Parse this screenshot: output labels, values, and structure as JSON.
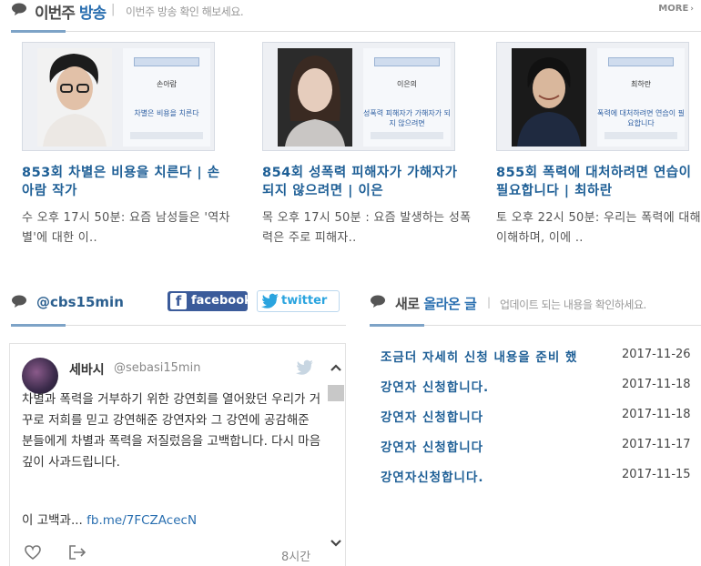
{
  "broadcast": {
    "title_part1": "이번주",
    "title_part2": "방송",
    "description": "이번주 방송 확인 해보세요.",
    "more_label": "MORE",
    "episodes": [
      {
        "poster_name": "손아람",
        "poster_topic": "차별은 비용을 치른다",
        "title": "853회 차별은 비용을 치른다 | 손아람 작가",
        "description": "수 오후 17시 50분: 요즘 남성들은 '역차별'에 대한 이.."
      },
      {
        "poster_name": "이은의",
        "poster_topic": "성폭력 피해자가 가해자가 되지 않으려면",
        "title": "854회 성폭력 피해자가 가해자가 되지 않으려면 | 이은",
        "description": "목 오후 17시 50분 : 요즘 발생하는 성폭력은 주로 피해자.."
      },
      {
        "poster_name": "최하란",
        "poster_topic": "폭력에 대처하려면 연습이 필요합니다",
        "title": "855회 폭력에 대처하려면 연습이 필요합니다 | 최하란",
        "description": "토 오후 22시 50분: 우리는 폭력에 대해 이해하며, 이에 .."
      }
    ]
  },
  "twitter_section": {
    "handle": "@cbs15min",
    "facebook_label": "facebook",
    "twitter_label": "twitter",
    "tweet": {
      "name": "세바시",
      "handle": "@sebasi15min",
      "text": "차별과 폭력을 거부하기 위한 강연회를 열어왔던 우리가 거꾸로 저희를 믿고 강연해준 강연자와 그 강연에 공감해준 분들에게 차별과 폭력을 저질렀음을 고백합니다. 다시 마음 깊이 사과드립니다.",
      "more_text": "이 고백과...",
      "link": "fb.me/7FCZAcecN",
      "time": "8시간"
    }
  },
  "new_posts": {
    "title_part1": "새로",
    "title_part2": "올라온 글",
    "description": "업데이트 되는 내용을 확인하세요.",
    "items": [
      {
        "title": "조금더 자세히 신청 내용을 준비 했",
        "date": "2017-11-26"
      },
      {
        "title": "강연자 신청합니다.",
        "date": "2017-11-18"
      },
      {
        "title": "강연자 신청합니다",
        "date": "2017-11-18"
      },
      {
        "title": "강연자 신청합니다",
        "date": "2017-11-17"
      },
      {
        "title": "강연자신청합니다.",
        "date": "2017-11-15"
      }
    ]
  },
  "colors": {
    "accent": "#2a6fb0",
    "link_title": "#1e5f96",
    "facebook": "#3b5b9a",
    "twitter": "#2aa4df"
  }
}
